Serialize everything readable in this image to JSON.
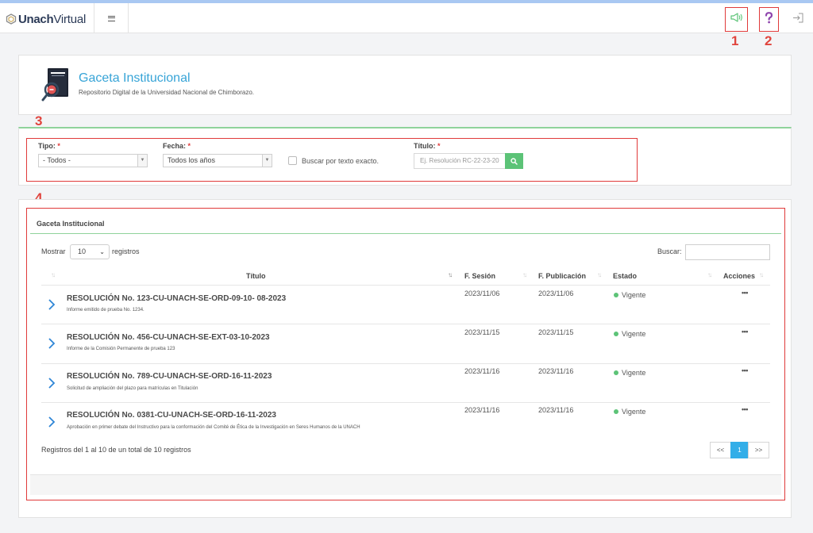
{
  "app": {
    "logo_bold": "Unach",
    "logo_light": "Virtual"
  },
  "annotations": [
    "1",
    "2",
    "3",
    "4"
  ],
  "header": {
    "title": "Gaceta Institucional",
    "subtitle": "Repositorio Digital de la Universidad Nacional de Chimborazo."
  },
  "filters": {
    "tipo_label": "Tipo:",
    "tipo_value": "- Todos -",
    "fecha_label": "Fecha:",
    "fecha_value": "Todos los años",
    "exact_label": "Buscar por texto exacto.",
    "titulo_label": "Título:",
    "titulo_placeholder": "Ej. Resolución RC-22-23-20",
    "required_mark": "*"
  },
  "table": {
    "card_title": "Gaceta Institucional",
    "show_label": "Mostrar",
    "length_value": "10",
    "records_label": "registros",
    "search_label": "Buscar:",
    "columns": [
      "Título",
      "F. Sesión",
      "F. Publicación",
      "Estado",
      "Acciones"
    ],
    "rows": [
      {
        "title": "RESOLUCIÓN No. 123-CU-UNACH-SE-ORD-09-10- 08-2023",
        "desc": "Informe emitido de prueba No. 1234.",
        "session": "2023/11/06",
        "published": "2023/11/06",
        "status": "Vigente",
        "action": "•••"
      },
      {
        "title": "RESOLUCIÓN No. 456-CU-UNACH-SE-EXT-03-10-2023",
        "desc": "Informe de la Comisión Permanente de prueba 123",
        "session": "2023/11/15",
        "published": "2023/11/15",
        "status": "Vigente",
        "action": "•••"
      },
      {
        "title": "RESOLUCIÓN No. 789-CU-UNACH-SE-ORD-16-11-2023",
        "desc": "Solicitud de ampliación del plazo para matrículas en Titulación",
        "session": "2023/11/16",
        "published": "2023/11/16",
        "status": "Vigente",
        "action": "•••"
      },
      {
        "title": "RESOLUCIÓN No. 0381-CU-UNACH-SE-ORD-16-11-2023",
        "desc": "Aprobación en primer debate del Instructivo para la conformación del Comité de Ética de la Investigación en Seres Humanos de la UNACH",
        "session": "2023/11/16",
        "published": "2023/11/16",
        "status": "Vigente",
        "action": "•••"
      }
    ],
    "info": "Registros del 1 al 10 de un total de 10 registros",
    "pager": {
      "prev": "<<",
      "current": "1",
      "next": ">>"
    }
  },
  "colors": {
    "accent": "#37a4d7",
    "success": "#5cc377",
    "annotation": "#e03a3a",
    "help": "#8e44ad"
  },
  "icons": {
    "announce": "megaphone-icon",
    "help": "question-icon",
    "logout": "sign-out-icon",
    "search": "search-icon",
    "expand": "chevron-right-icon"
  }
}
